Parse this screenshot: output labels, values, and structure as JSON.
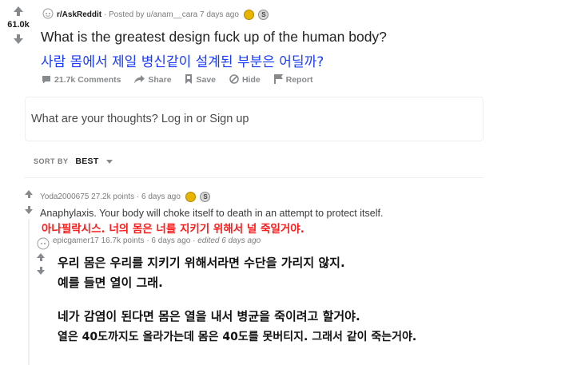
{
  "post": {
    "subreddit": "r/AskReddit",
    "posted_by": "· Posted by u/anam__cara 7 days ago",
    "score": "61.0k",
    "title": "What is the greatest design fuck up of the human body?",
    "title_korean": "사람 몸에서 제일 병신같이 설계된 부분은 어딜까?",
    "actions": {
      "comments": "21.7k Comments",
      "share": "Share",
      "save": "Save",
      "hide": "Hide",
      "report": "Report"
    }
  },
  "comment_box": {
    "placeholder": "What are your thoughts? Log in or Sign up"
  },
  "sort": {
    "label": "SORT BY",
    "value": "BEST"
  },
  "comments": [
    {
      "author": "Yoda2000675",
      "points": "27.2k points",
      "age": "· 6 days ago",
      "body": "Anaphylaxis. Your body will choke itself to death in an attempt to protect itself.",
      "translation": "아나필락시스. 너의 몸은 너를 지키기 위해서 널 죽일거야."
    },
    {
      "author": "epicgamer17",
      "points": "16.7k points",
      "age": "· 6 days ago ·",
      "edited": "edited 6 days ago",
      "translation_lines": [
        "우리 몸은 우리를 지키기 위해서라면 수단을 가리지 않지.",
        "예를 들면 열이 그래.",
        "네가 감염이 된다면 몸은 열을 내서 병균을 죽이려고 할거야.",
        "열은 40도까지도 올라가는데 몸은 40도를 못버티지. 그래서 같이 죽는거야."
      ]
    }
  ],
  "award_symbol": "S",
  "colors": {
    "korean_blue": "#1a3cff",
    "korean_red": "#ff1a1a",
    "gold": "#e7b400",
    "meta_gray": "#7c7c7c"
  }
}
